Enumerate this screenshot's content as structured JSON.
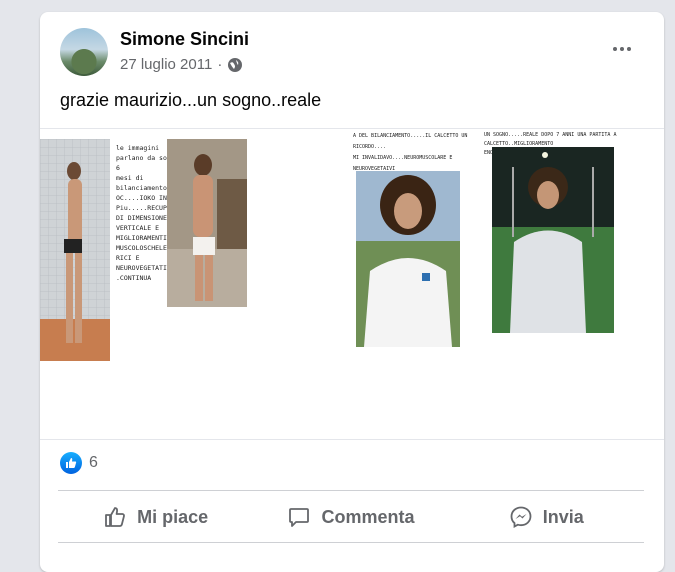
{
  "post": {
    "author": "Simone Sincini",
    "date": "27 luglio 2011",
    "separator": "·",
    "audience_icon": "globe-icon",
    "caption": "grazie maurizio...un sogno..reale"
  },
  "photos": {
    "panel1_text": "le immagini\nparlano da sole 6\nmesi di\nbilanciamento.......\nOC....IOKO IN\nPiu.....RECUPERO\nDI DIMENSIONE\nVERTICALE E\nMIGLIORAMENTI\nMUSCOLOSCHELET\nRICI E\nNEUROVEGETATIV...\n.CONTINUA",
    "panel2_text": "A DEL BILANCIAMENTO.....IL CALCETTO UN RICORDO....\nMI INVALIDAVO....NEUROMUSCOLARE E NEUROVEGETAIVI",
    "panel3_text": "UN SOGNO.....REALE DOPO 7 ANNI UNA PARTITA A CALCETTO..MIGLIORAMENTO\nENORMI.....CONTINUA....."
  },
  "reactions": {
    "icon": "like-icon",
    "count": "6"
  },
  "actions": {
    "like": "Mi piace",
    "comment": "Commenta",
    "share": "Invia"
  },
  "colors": {
    "background": "#e4e6eb",
    "card": "#ffffff",
    "secondary_text": "#65676b",
    "like_blue": "#0866ff"
  }
}
